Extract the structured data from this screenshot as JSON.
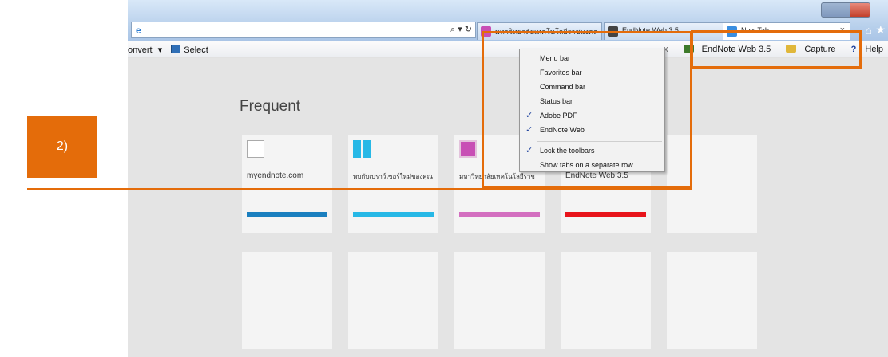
{
  "browser": {
    "address_buttons": "⌕ ▾ ↻",
    "tabs": [
      {
        "label": "มหาวิทยาลัยเทคโนโลยีราชมงคล",
        "favicon_color": "#c84fb5"
      },
      {
        "label": "EndNote Web 3.5",
        "favicon_color": "#333333"
      },
      {
        "label": "New Tab",
        "favicon_color": "#3a8ee0",
        "active": true
      }
    ],
    "tab_close": "×"
  },
  "command_bar": {
    "convert_label": "onvert",
    "convert_arrow": "▾",
    "select_label": "Select",
    "close_x": "x",
    "endnote_label": "EndNote Web 3.5",
    "capture_label": "Capture",
    "help_icon": "?",
    "help_label": "Help"
  },
  "content": {
    "section_title": "Frequent",
    "tiles_top": [
      {
        "label": "myendnote.com",
        "bar_color": "#1a7fbf",
        "icon": "blank-page-icon"
      },
      {
        "label": "พบกับเบราว์เซอร์ใหม่ของคุณ",
        "bar_color": "#27b8e6",
        "icon": "windows-icon"
      },
      {
        "label": "มหาวิทยาลัยเทคโนโลยีราช",
        "bar_color": "#d36fc0",
        "icon": "university-icon"
      },
      {
        "label": "EndNote Web 3.5",
        "bar_color": "#e8141b",
        "icon": "endnote-icon"
      }
    ]
  },
  "context_menu": {
    "items": [
      {
        "label": "Menu bar",
        "checked": false
      },
      {
        "label": "Favorites bar",
        "checked": false
      },
      {
        "label": "Command bar",
        "checked": false
      },
      {
        "label": "Status bar",
        "checked": false
      },
      {
        "label": "Adobe PDF",
        "checked": true
      },
      {
        "label": "EndNote Web",
        "checked": true
      },
      {
        "label": "Lock the toolbars",
        "checked": true
      },
      {
        "label": "Show tabs on a separate row",
        "checked": false
      }
    ],
    "check_glyph": "✓"
  },
  "annotation": {
    "step_label": "2)",
    "accent_color": "#e46c0a"
  }
}
